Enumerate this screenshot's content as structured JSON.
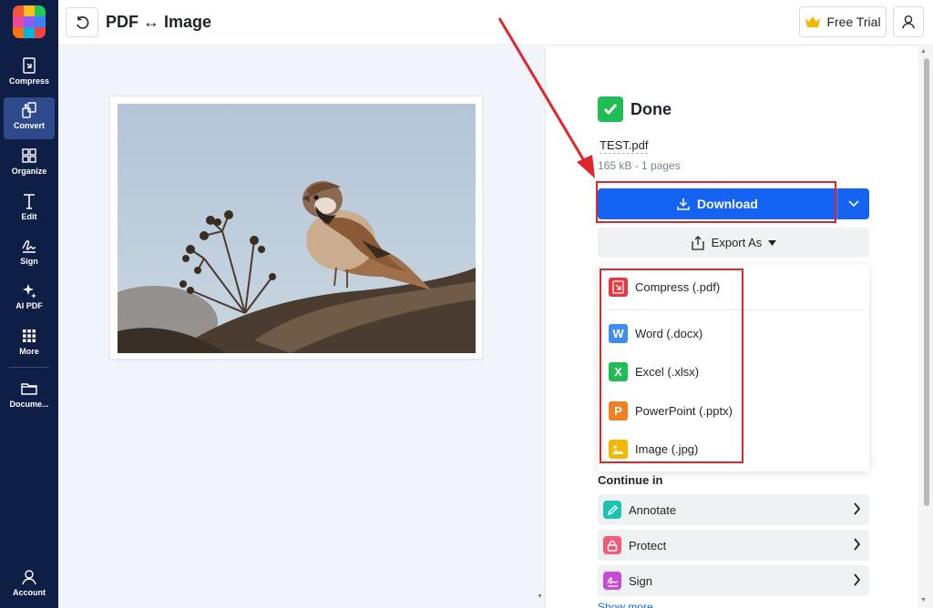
{
  "app": {
    "title": "PDF ↔ Image",
    "logo_colors": [
      "#f2563a",
      "#fbbf24",
      "#22c55e",
      "#ec4899",
      "#8b5cf6",
      "#3b82f6",
      "#f97316",
      "#06b6d4",
      "#ef4444"
    ]
  },
  "sidebar": {
    "items": [
      {
        "label": "Compress",
        "icon": "compress-icon"
      },
      {
        "label": "Convert",
        "icon": "convert-icon",
        "active": true
      },
      {
        "label": "Organize",
        "icon": "grid-icon"
      },
      {
        "label": "Edit",
        "icon": "text-edit-icon"
      },
      {
        "label": "Sign",
        "icon": "signature-icon"
      },
      {
        "label": "AI PDF",
        "icon": "sparkle-icon"
      },
      {
        "label": "More",
        "icon": "dots-grid-icon"
      },
      {
        "label": "Docume...",
        "icon": "folder-icon"
      },
      {
        "label": "Account",
        "icon": "user-icon"
      }
    ]
  },
  "topbar": {
    "free_trial_label": "Free Trial"
  },
  "result": {
    "status": "Done",
    "file_name": "TEST.pdf",
    "file_meta": "165 kB - 1 pages",
    "download_label": "Download",
    "export_label": "Export As",
    "accent": "#1463f3",
    "highlight_color": "#e0262b"
  },
  "export_menu": {
    "items": [
      {
        "label": "Compress (.pdf)",
        "icon": "compress-pdf-icon",
        "color": "#e5393f"
      },
      {
        "label": "Word (.docx)",
        "icon": "word-icon",
        "color": "#3d8ef0"
      },
      {
        "label": "Excel (.xlsx)",
        "icon": "excel-icon",
        "color": "#1fbd53"
      },
      {
        "label": "PowerPoint (.pptx)",
        "icon": "powerpoint-icon",
        "color": "#f08122"
      },
      {
        "label": "Image (.jpg)",
        "icon": "image-icon",
        "color": "#f5b700"
      }
    ]
  },
  "continue_in": {
    "label": "Continue in",
    "items": [
      {
        "label": "Annotate",
        "icon": "pen-icon",
        "color": "#1cc2b6"
      },
      {
        "label": "Protect",
        "icon": "lock-icon",
        "color": "#f25b76"
      },
      {
        "label": "Sign",
        "icon": "signature-icon",
        "color": "#c64bd8"
      }
    ],
    "show_more": "Show more"
  }
}
